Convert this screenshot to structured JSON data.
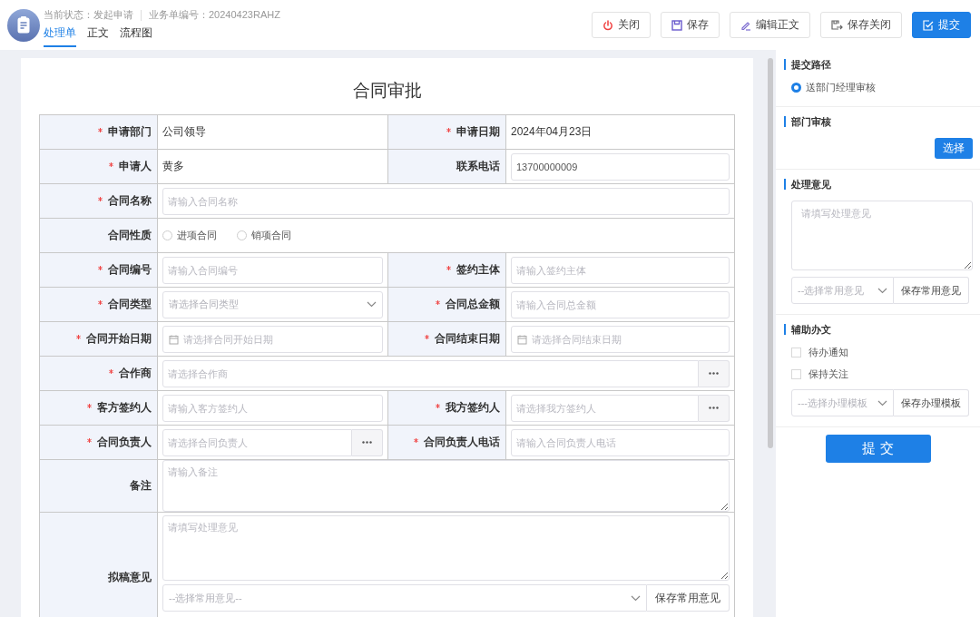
{
  "header": {
    "status": "当前状态：发起申请",
    "number": "业务单编号：20240423RAHZ"
  },
  "tabs": [
    {
      "label": "处理单",
      "selected": true
    },
    {
      "label": "正文",
      "selected": false
    },
    {
      "label": "流程图",
      "selected": false
    }
  ],
  "actions": [
    {
      "kind": "close",
      "label": "关闭"
    },
    {
      "kind": "save",
      "label": "保存"
    },
    {
      "kind": "edit",
      "label": "编辑正文"
    },
    {
      "kind": "save_close",
      "label": "保存关闭"
    },
    {
      "kind": "submit",
      "label": "提交"
    }
  ],
  "form": {
    "title": "合同审批",
    "rows": [
      [
        {
          "label": "申请部门",
          "required": true,
          "kind": "text",
          "value": "公司领导"
        },
        {
          "label": "申请日期",
          "required": true,
          "kind": "text",
          "value": "2024年04月23日"
        }
      ],
      [
        {
          "label": "申请人",
          "required": true,
          "kind": "text",
          "value": "黄多"
        },
        {
          "label": "联系电话",
          "required": false,
          "kind": "input",
          "value": "13700000009"
        }
      ],
      [
        {
          "label": "合同名称",
          "required": true,
          "kind": "input",
          "placeholder": "请输入合同名称"
        }
      ],
      [
        {
          "label": "合同性质",
          "required": false,
          "kind": "radio",
          "options": [
            {
              "label": "进项合同",
              "selected": false
            },
            {
              "label": "销项合同",
              "selected": false
            }
          ]
        }
      ],
      [
        {
          "label": "合同编号",
          "required": true,
          "kind": "input",
          "placeholder": "请输入合同编号"
        },
        {
          "label": "签约主体",
          "required": true,
          "kind": "input",
          "placeholder": "请输入签约主体"
        }
      ],
      [
        {
          "label": "合同类型",
          "required": true,
          "kind": "select",
          "placeholder": "请选择合同类型"
        },
        {
          "label": "合同总金额",
          "required": true,
          "kind": "input",
          "placeholder": "请输入合同总金额"
        }
      ],
      [
        {
          "label": "合同开始日期",
          "required": true,
          "kind": "date",
          "placeholder": "请选择合同开始日期"
        },
        {
          "label": "合同结束日期",
          "required": true,
          "kind": "date",
          "placeholder": "请选择合同结束日期"
        }
      ],
      [
        {
          "label": "合作商",
          "required": true,
          "kind": "picker",
          "placeholder": "请选择合作商"
        }
      ],
      [
        {
          "label": "客方签约人",
          "required": true,
          "kind": "input",
          "placeholder": "请输入客方签约人"
        },
        {
          "label": "我方签约人",
          "required": true,
          "kind": "picker",
          "placeholder": "请选择我方签约人"
        }
      ],
      [
        {
          "label": "合同负责人",
          "required": true,
          "kind": "picker",
          "placeholder": "请选择合同负责人"
        },
        {
          "label": "合同负责人电话",
          "required": true,
          "kind": "input",
          "placeholder": "请输入合同负责人电话"
        }
      ],
      [
        {
          "label": "备注",
          "required": false,
          "kind": "textarea",
          "placeholder": "请输入备注"
        }
      ],
      [
        {
          "label": "拟稿意见",
          "required": false,
          "kind": "opinion",
          "placeholder": "请填写处理意见",
          "select": "--选择常用意见--",
          "button": "保存常用意见"
        }
      ]
    ]
  },
  "sidebar": {
    "sections": [
      {
        "title": "提交路径",
        "kind": "route",
        "options": [
          {
            "label": "送部门经理审核",
            "selected": true
          }
        ]
      },
      {
        "title": "部门审核",
        "kind": "pick",
        "button": "选择"
      },
      {
        "title": "处理意见",
        "kind": "opinion",
        "placeholder": "请填写处理意见",
        "select": "--选择常用意见",
        "button": "保存常用意见"
      },
      {
        "title": "辅助办文",
        "kind": "assist",
        "options": [
          {
            "label": "待办通知",
            "checked": false
          },
          {
            "label": "保持关注",
            "checked": false
          }
        ],
        "select": "---选择办理模板",
        "button": "保存办理模板"
      }
    ],
    "submit": "提 交"
  }
}
